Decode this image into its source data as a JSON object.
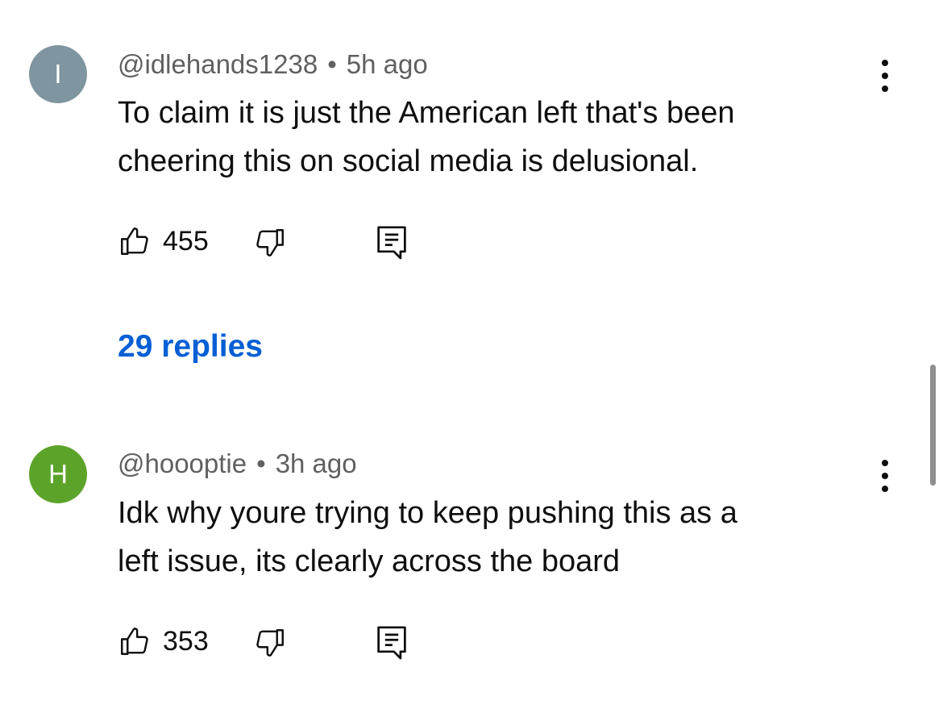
{
  "comments": [
    {
      "avatar_letter": "I",
      "avatar_color": "#7f95a0",
      "handle": "@idlehands1238",
      "separator": "•",
      "time": "5h ago",
      "text_lines": [
        "To claim it is just the American left that's been",
        "cheering this on social media is delusional."
      ],
      "likes": "455",
      "replies_label": "29 replies"
    },
    {
      "avatar_letter": "H",
      "avatar_color": "#5ca32a",
      "handle": "@hoooptie",
      "separator": "•",
      "time": "3h ago",
      "text_lines": [
        "Idk why youre trying to keep pushing this as a",
        "left issue, its clearly across the board"
      ],
      "likes": "353"
    }
  ],
  "icons": {
    "like": "thumbs-up-icon",
    "dislike": "thumbs-down-icon",
    "reply": "reply-comment-icon",
    "more": "more-vertical-icon"
  },
  "colors": {
    "link": "#065fd4",
    "meta_text": "#606060"
  }
}
